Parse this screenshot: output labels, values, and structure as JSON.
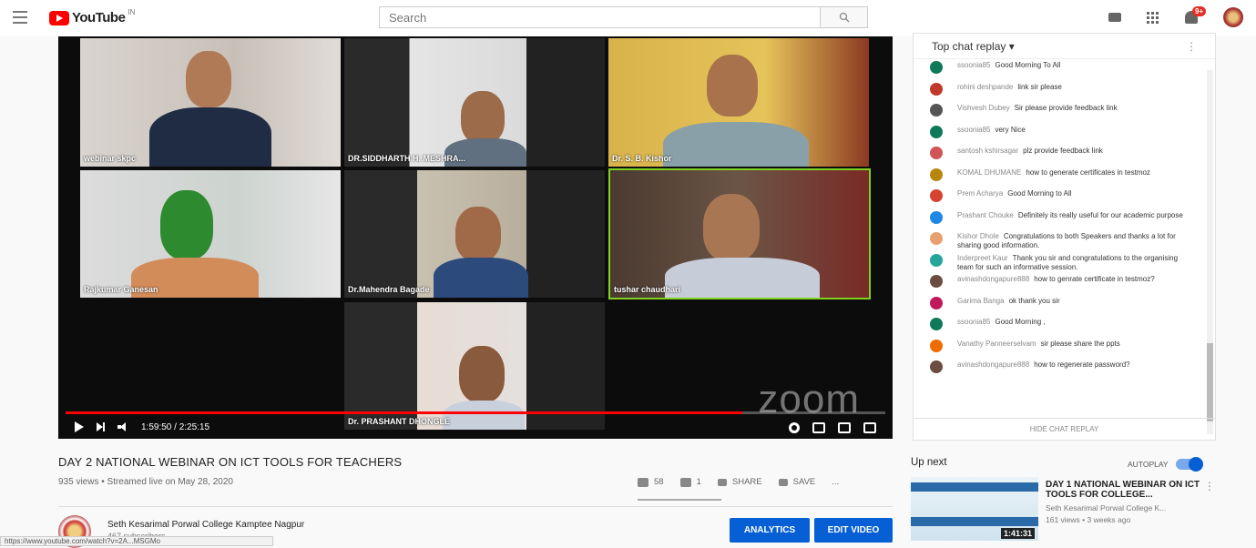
{
  "header": {
    "logo_text": "YouTube",
    "logo_region": "IN",
    "search_placeholder": "Search",
    "notification_count": "9+"
  },
  "video": {
    "participants": [
      {
        "name": "webinar skpc"
      },
      {
        "name": "DR.SIDDHARTH H. MESHRA..."
      },
      {
        "name": "Dr. S. B. Kishor"
      },
      {
        "name": "Rajkumar Ganesan"
      },
      {
        "name": "Dr.Mahendra Bagade"
      },
      {
        "name": "tushar chaudhari"
      },
      {
        "name": "Dr. PRASHANT DHONGLE"
      }
    ],
    "watermark": "zoom",
    "time": "1:59:50 / 2:25:15",
    "progress": 0.825,
    "title": "DAY 2 NATIONAL WEBINAR ON ICT TOOLS FOR TEACHERS",
    "meta": "935 views • Streamed live on May 28, 2020",
    "likes": "58",
    "dislikes": "1",
    "share_label": "SHARE",
    "save_label": "SAVE",
    "more_label": "..."
  },
  "channel": {
    "name": "Seth Kesarimal Porwal College Kamptee Nagpur",
    "subscribers": "467 subscribers",
    "analytics_label": "ANALYTICS",
    "edit_label": "EDIT VIDEO"
  },
  "statusbar": "https://www.youtube.com/watch?v=2A...MSGMo",
  "chat": {
    "title": "Top chat replay",
    "footer": "HIDE CHAT REPLAY",
    "messages": [
      {
        "author": "ssoonia85",
        "text": "Good Morning To All",
        "color": "#0f7a5a"
      },
      {
        "author": "rohini deshpande",
        "text": "link sir please",
        "color": "#c0392b"
      },
      {
        "author": "Vishvesh Dubey",
        "text": "Sir please provide feedback link",
        "color": "#555555"
      },
      {
        "author": "ssoonia85",
        "text": "very Nice",
        "color": "#0f7a5a"
      },
      {
        "author": "santosh kshirsagar",
        "text": "plz provide feedback link",
        "color": "#d35454"
      },
      {
        "author": "KOMAL DHUMANE",
        "text": "how to generate certificates in testmoz",
        "color": "#b8860b"
      },
      {
        "author": "Prem Acharya",
        "text": "Good Morning to All",
        "color": "#d64430"
      },
      {
        "author": "Prashant Chouke",
        "text": "Definitely its really useful for our academic purpose",
        "color": "#1e88e5"
      },
      {
        "author": "Kishor Dhole",
        "text": "Congratulations to both Speakers and thanks a lot for sharing good information.",
        "color": "#e8a070"
      },
      {
        "author": "Inderpreet Kaur",
        "text": "Thank you sir and congratulations to the organising team for such an informative session.",
        "color": "#26a69a"
      },
      {
        "author": "avinashdongapure888",
        "text": "how to genrate certificate in testmoz?",
        "color": "#6d4c41"
      },
      {
        "author": "Garima Banga",
        "text": "ok thank you sir",
        "color": "#c2185b"
      },
      {
        "author": "ssoonia85",
        "text": "Good Morning ,",
        "color": "#0f7a5a"
      },
      {
        "author": "Vanathy Panneerselvam",
        "text": "sir please share the ppts",
        "color": "#ef6c00"
      },
      {
        "author": "avinashdongapure888",
        "text": "how to regenerate password?",
        "color": "#6d4c41"
      }
    ]
  },
  "up_next": {
    "label": "Up next",
    "autoplay_label": "AUTOPLAY",
    "autoplay_on": true,
    "title": "DAY 1 NATIONAL WEBINAR ON ICT TOOLS FOR COLLEGE...",
    "channel": "Seth Kesarimal Porwal College K...",
    "views": "161 views • 3 weeks ago",
    "duration": "1:41:31"
  },
  "colors": {
    "accent": "#065fd4",
    "progress": "#ff0000",
    "active_speaker": "#7ed321"
  }
}
